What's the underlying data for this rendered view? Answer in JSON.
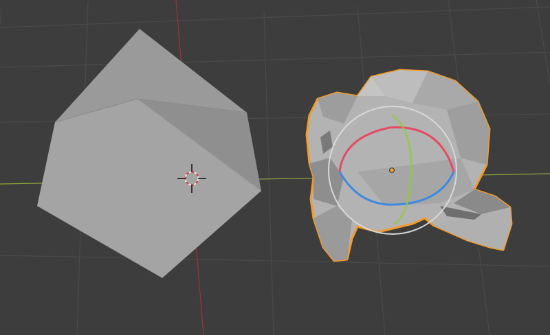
{
  "viewport": {
    "mode": "object-mode",
    "background_color": "#3d3d3d",
    "grid_color": "#4a4a4a",
    "x_axis_color": "#8fa83c",
    "y_axis_color": "#a0323c"
  },
  "objects": [
    {
      "name": "cube",
      "selected": false,
      "face_color": "#a2a2a2"
    },
    {
      "name": "monkey",
      "selected": true,
      "face_color": "#b4b4b4",
      "outline_color": "#f39b2b"
    }
  ],
  "cursor_3d": {
    "colors": [
      "#e8e8e8",
      "#d23a3a"
    ]
  },
  "rotate_gizmo": {
    "trackball_color": "#d8d8d8",
    "x_ring_color": "#e44b63",
    "y_ring_color": "#8ccd33",
    "z_ring_color": "#3d8ae0",
    "pivot_color": "#f0a23a"
  }
}
